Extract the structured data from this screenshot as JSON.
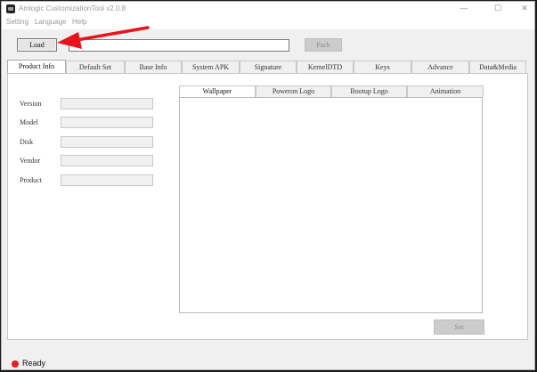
{
  "window": {
    "title": "Amlogic CustomizationTool v2.0.8",
    "controls": [
      "—",
      "☐",
      "✕"
    ]
  },
  "menu": [
    "Setting",
    "Language",
    "Help"
  ],
  "toolbar": {
    "load_label": "Load",
    "path_value": "",
    "pack_label": "Pack"
  },
  "tabs": [
    "Product Info",
    "Default Set",
    "Base Info",
    "System APK",
    "Signature",
    "KernelDTD",
    "Keys",
    "Advance",
    "Data&Media"
  ],
  "active_tab": "Product Info",
  "product_info": {
    "fields": [
      {
        "label": "Version",
        "value": ""
      },
      {
        "label": "Model",
        "value": ""
      },
      {
        "label": "Disk",
        "value": ""
      },
      {
        "label": "Vendor",
        "value": ""
      },
      {
        "label": "Product",
        "value": ""
      }
    ],
    "subtabs": [
      "Wallpaper",
      "Poweron Logo",
      "Bootup Logo",
      "Animation"
    ],
    "active_subtab": "Wallpaper",
    "set_label": "Set"
  },
  "status": {
    "text": "Ready",
    "color": "#e2211c"
  },
  "annotation": {
    "color": "#e8141b"
  }
}
